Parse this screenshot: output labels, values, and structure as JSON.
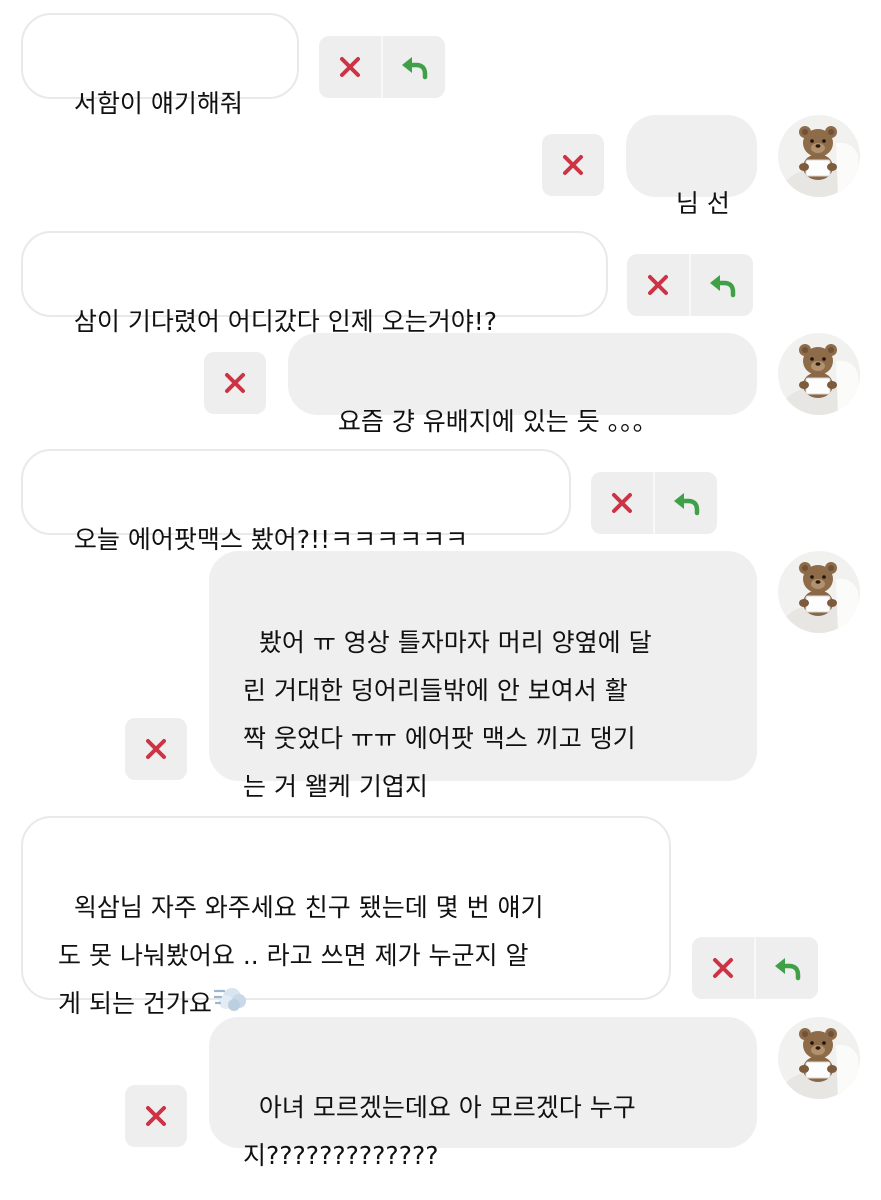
{
  "colors": {
    "delete": "#cc3344",
    "reply": "#3fa047",
    "bubble_in_border": "#e9e9e9",
    "bubble_out_bg": "#efefef",
    "action_bg": "#eeeeee"
  },
  "icons": {
    "delete": "close-icon",
    "reply": "reply-arrow-icon",
    "avatar": "teddy-bear-avatar",
    "emoji": "dashing-away-emoji"
  },
  "messages": [
    {
      "side": "in",
      "text": "서함이 얘기해줘"
    },
    {
      "side": "out",
      "text": "님 선"
    },
    {
      "side": "in",
      "text": "삼이 기다렸어 어디갔다 인제 오는거야!?"
    },
    {
      "side": "out",
      "text": "요즘 걍 유배지에 있는 듯 。。。"
    },
    {
      "side": "in",
      "text": "오늘 에어팟맥스 봤어?!!ㅋㅋㅋㅋㅋㅋ"
    },
    {
      "side": "out",
      "text": "봤어 ㅠ 영상 틀자마자 머리 양옆에 달\n린 거대한 덩어리들밖에 안 보여서 활\n짝 웃었다 ㅠㅠ 에어팟 맥스 끼고 댕기\n는 거 왤케 기엽지"
    },
    {
      "side": "in",
      "text": "왹삼님 자주 와주세요 친구 됐는데 몇 번 얘기\n도 못 나눠봤어요 .. 라고 쓰면 제가 누군지 알\n게 되는 건가요"
    },
    {
      "side": "out",
      "text": "아녀 모르겠는데요 아 모르겠다 누구\n지?????????????"
    }
  ]
}
